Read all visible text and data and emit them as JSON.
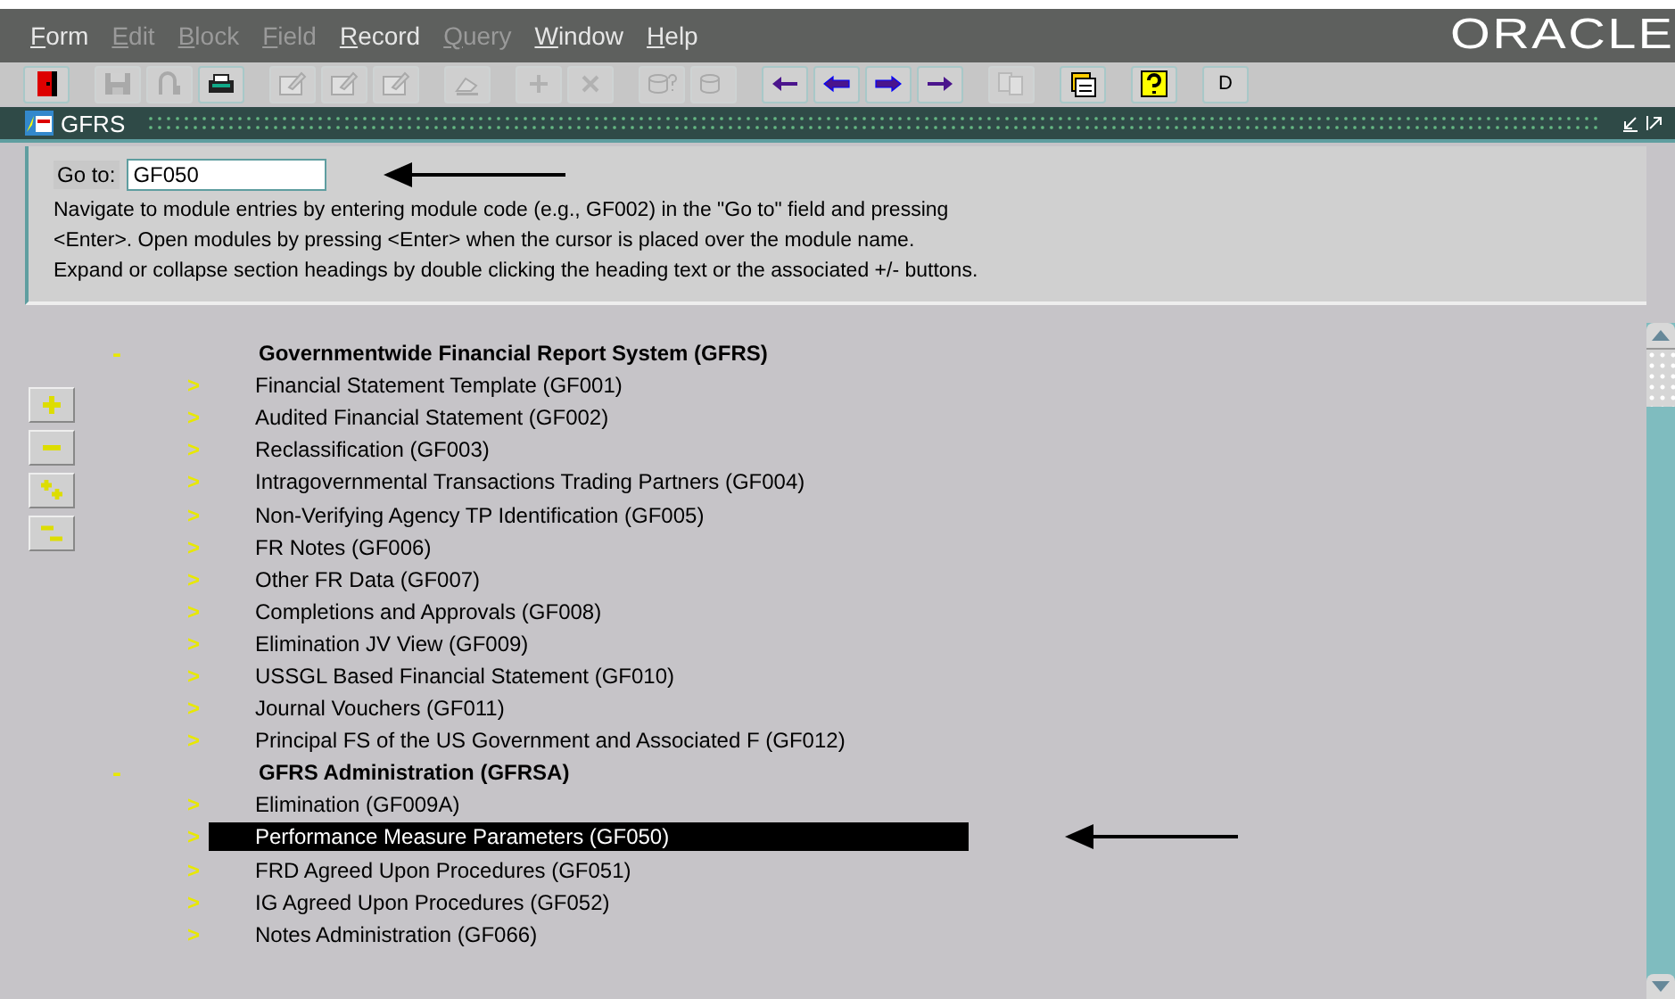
{
  "menu": [
    {
      "label": "Form",
      "disabled": false
    },
    {
      "label": "Edit",
      "disabled": true
    },
    {
      "label": "Block",
      "disabled": true
    },
    {
      "label": "Field",
      "disabled": true
    },
    {
      "label": "Record",
      "disabled": false
    },
    {
      "label": "Query",
      "disabled": true
    },
    {
      "label": "Window",
      "disabled": false
    },
    {
      "label": "Help",
      "disabled": false
    }
  ],
  "brand": "ORACLE",
  "toolbar": [
    [
      {
        "kind": "exit",
        "disabled": false
      }
    ],
    [
      {
        "kind": "save",
        "disabled": true
      },
      {
        "kind": "revert",
        "disabled": true
      },
      {
        "kind": "print",
        "disabled": false
      }
    ],
    [
      {
        "kind": "edit",
        "disabled": true
      },
      {
        "kind": "edit",
        "disabled": true
      },
      {
        "kind": "edit",
        "disabled": true
      }
    ],
    [
      {
        "kind": "clear",
        "disabled": true
      }
    ],
    [
      {
        "kind": "insert",
        "disabled": true
      },
      {
        "kind": "delete",
        "disabled": true
      }
    ],
    [
      {
        "kind": "query",
        "disabled": true
      },
      {
        "kind": "count",
        "disabled": true
      }
    ],
    [
      {
        "kind": "first",
        "disabled": false
      },
      {
        "kind": "prev",
        "disabled": false
      },
      {
        "kind": "next",
        "disabled": false
      },
      {
        "kind": "last",
        "disabled": false
      }
    ],
    [
      {
        "kind": "copy",
        "disabled": true
      }
    ],
    [
      {
        "kind": "list",
        "disabled": false
      }
    ],
    [
      {
        "kind": "help",
        "disabled": false
      }
    ],
    [
      {
        "kind": "text",
        "label": "D",
        "disabled": false
      }
    ]
  ],
  "window": {
    "title": "GFRS"
  },
  "goto": {
    "label": "Go to:",
    "value": "GF050"
  },
  "instructions": "Navigate to module entries by entering module code (e.g., GF002) in the \"Go to\" field and pressing <Enter>.  Open modules by pressing <Enter> when the cursor is placed over the module name.  Expand or collapse section headings by double clicking the heading text or the associated +/- buttons.",
  "side_buttons": [
    {
      "kind": "expand"
    },
    {
      "kind": "collapse"
    },
    {
      "kind": "expand-all"
    },
    {
      "kind": "collapse-all"
    }
  ],
  "sections": [
    {
      "marker": "-",
      "label": "Governmentwide Financial Report System  (GFRS)",
      "items": [
        {
          "marker": ">",
          "label": "Financial Statement Template  (GF001)",
          "selected": false
        },
        {
          "marker": ">",
          "label": "Audited Financial Statement  (GF002)",
          "selected": false
        },
        {
          "marker": ">",
          "label": "Reclassification  (GF003)",
          "selected": false
        },
        {
          "marker": ">",
          "label": "Intragovernmental Transactions Trading Partners  (GF004)",
          "selected": false
        },
        {
          "marker": ">",
          "label": "Non-Verifying Agency TP Identification  (GF005)",
          "selected": false
        },
        {
          "marker": ">",
          "label": "FR Notes  (GF006)",
          "selected": false
        },
        {
          "marker": ">",
          "label": "Other FR Data  (GF007)",
          "selected": false
        },
        {
          "marker": ">",
          "label": "Completions and Approvals  (GF008)",
          "selected": false
        },
        {
          "marker": ">",
          "label": "Elimination JV View  (GF009)",
          "selected": false
        },
        {
          "marker": ">",
          "label": "USSGL Based Financial Statement  (GF010)",
          "selected": false
        },
        {
          "marker": ">",
          "label": "Journal Vouchers  (GF011)",
          "selected": false
        },
        {
          "marker": ">",
          "label": "Principal FS of the US Government and Associated F  (GF012)",
          "selected": false
        }
      ]
    },
    {
      "marker": "-",
      "label": "GFRS Administration  (GFRSA)",
      "items": [
        {
          "marker": ">",
          "label": "Elimination  (GF009A)",
          "selected": false
        },
        {
          "marker": ">",
          "label": "Performance Measure Parameters  (GF050)",
          "selected": true
        },
        {
          "marker": ">",
          "label": "FRD Agreed Upon Procedures  (GF051)",
          "selected": false
        },
        {
          "marker": ">",
          "label": "IG Agreed Upon Procedures  (GF052)",
          "selected": false
        },
        {
          "marker": ">",
          "label": "Notes Administration  (GF066)",
          "selected": false
        }
      ]
    }
  ]
}
